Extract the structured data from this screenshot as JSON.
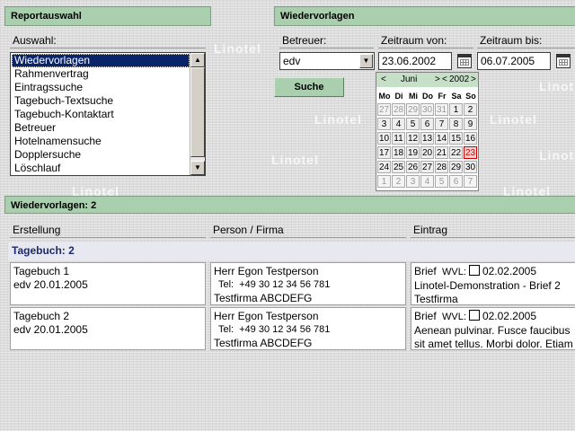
{
  "watermark": "Linotel",
  "report": {
    "header": "Reportauswahl",
    "label": "Auswahl:",
    "items": [
      "Wiedervorlagen",
      "Rahmenvertrag",
      "Eintragssuche",
      "Tagebuch-Textsuche",
      "Tagebuch-Kontaktart",
      "Betreuer",
      "Hotelnamensuche",
      "Dopplersuche",
      "Löschlauf"
    ],
    "selected_index": 0
  },
  "filter": {
    "header": "Wiedervorlagen",
    "betreuer_label": "Betreuer:",
    "betreuer_value": "edv",
    "von_label": "Zeitraum von:",
    "von_value": "23.06.2002",
    "bis_label": "Zeitraum bis:",
    "bis_value": "06.07.2005",
    "search_button": "Suche"
  },
  "calendar": {
    "prev": "<",
    "month": "Juni",
    "next": ">",
    "prev_year": "<",
    "year": "2002",
    "next_year": ">",
    "weekdays": [
      "Mo",
      "Di",
      "Mi",
      "Do",
      "Fr",
      "Sa",
      "So"
    ],
    "weeks": [
      [
        "27",
        "28",
        "29",
        "30",
        "31",
        "1",
        "2"
      ],
      [
        "3",
        "4",
        "5",
        "6",
        "7",
        "8",
        "9"
      ],
      [
        "10",
        "11",
        "12",
        "13",
        "14",
        "15",
        "16"
      ],
      [
        "17",
        "18",
        "19",
        "20",
        "21",
        "22",
        "23"
      ],
      [
        "24",
        "25",
        "26",
        "27",
        "28",
        "29",
        "30"
      ],
      [
        "1",
        "2",
        "3",
        "4",
        "5",
        "6",
        "7"
      ]
    ],
    "other_month_rows": {
      "first_row_count": 5,
      "last_row_all": true
    },
    "highlight": "23"
  },
  "results": {
    "header": "Wiedervorlagen: 2",
    "columns": [
      "Erstellung",
      "Person / Firma",
      "Eintrag"
    ],
    "group_title": "Tagebuch: 2",
    "rows": [
      {
        "title": "Tagebuch 1",
        "created": "edv 20.01.2005",
        "person": "Herr Egon Testperson",
        "tel_label": "Tel:",
        "tel": "+49 30 12 34 56 781",
        "company": "Testfirma ABCDEFG",
        "type": "Brief",
        "wvl_label": "WVL:",
        "wvl_date": "02.02.2005",
        "entry_line1": "Linotel-Demonstration - Brief 2",
        "entry_line2": "Testfirma"
      },
      {
        "title": "Tagebuch 2",
        "created": "edv 20.01.2005",
        "person": "Herr Egon Testperson",
        "tel_label": "Tel:",
        "tel": "+49 30 12 34 56 781",
        "company": "Testfirma ABCDEFG",
        "type": "Brief",
        "wvl_label": "WVL:",
        "wvl_date": "02.02.2005",
        "entry_line1": "Aenean pulvinar. Fusce faucibus",
        "entry_line2": "sit amet tellus. Morbi dolor. Etiam"
      }
    ]
  }
}
